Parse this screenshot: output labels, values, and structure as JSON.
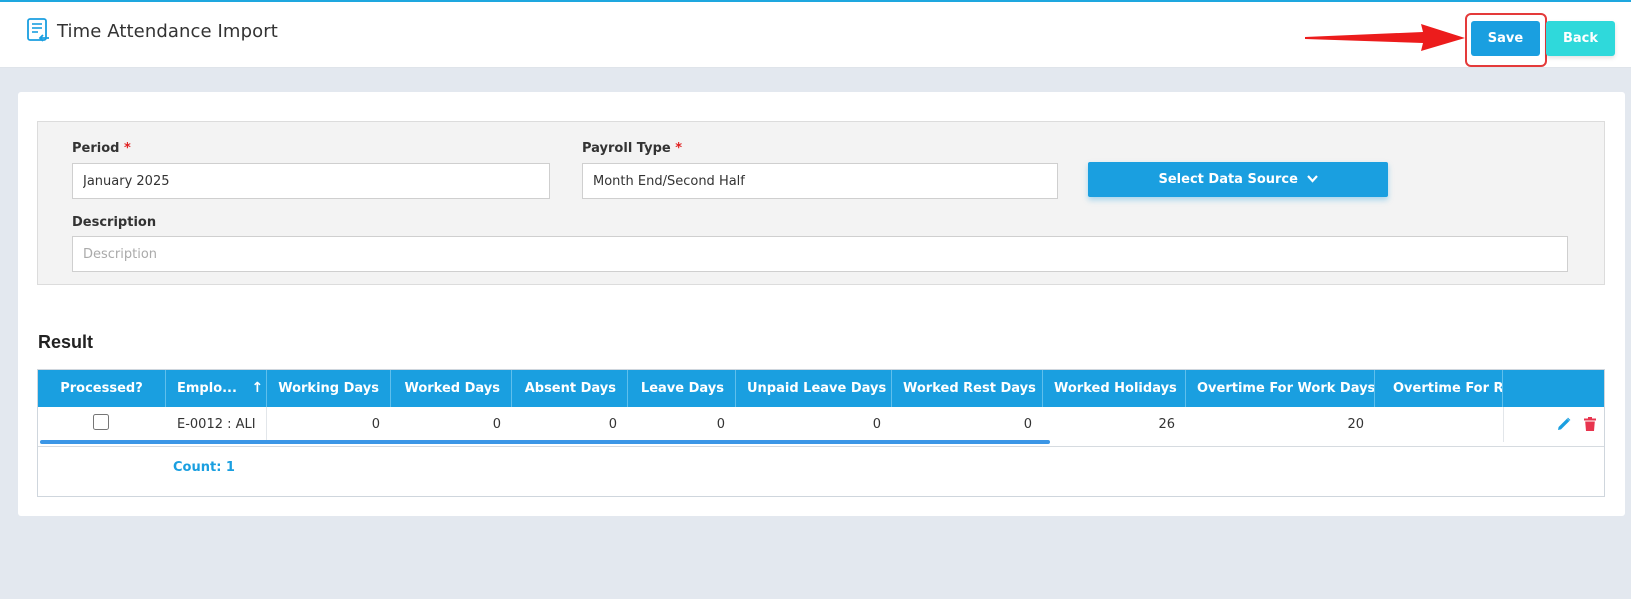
{
  "header": {
    "title": "Time Attendance Import",
    "icon": "import-document-icon",
    "save_label": "Save",
    "back_label": "Back"
  },
  "form": {
    "period_label": "Period",
    "period_value": "January 2025",
    "payroll_type_label": "Payroll Type",
    "payroll_type_value": "Month End/Second Half",
    "required_mark": "*",
    "data_source_label": "Select Data Source",
    "description_label": "Description",
    "description_placeholder": "Description",
    "description_value": ""
  },
  "result": {
    "title": "Result",
    "columns": [
      "Processed?",
      "Emplo...",
      "Working Days",
      "Worked Days",
      "Absent Days",
      "Leave Days",
      "Unpaid Leave Days",
      "Worked Rest Days",
      "Worked Holidays",
      "Overtime For Work Days",
      "Overtime For Rest Days"
    ],
    "rows": [
      {
        "processed": false,
        "employee": "E-0012 : ALI",
        "working_days": "0",
        "worked_days": "0",
        "absent_days": "0",
        "leave_days": "0",
        "unpaid_leave_days": "0",
        "worked_rest_days": "0",
        "worked_holidays": "26",
        "overtime_work_days": "20"
      }
    ],
    "count_label": "Count: 1"
  },
  "colors": {
    "primary": "#1a9fe0",
    "back_button": "#2fd9db",
    "delete": "#e8344e",
    "highlight": "#e43a3a"
  }
}
